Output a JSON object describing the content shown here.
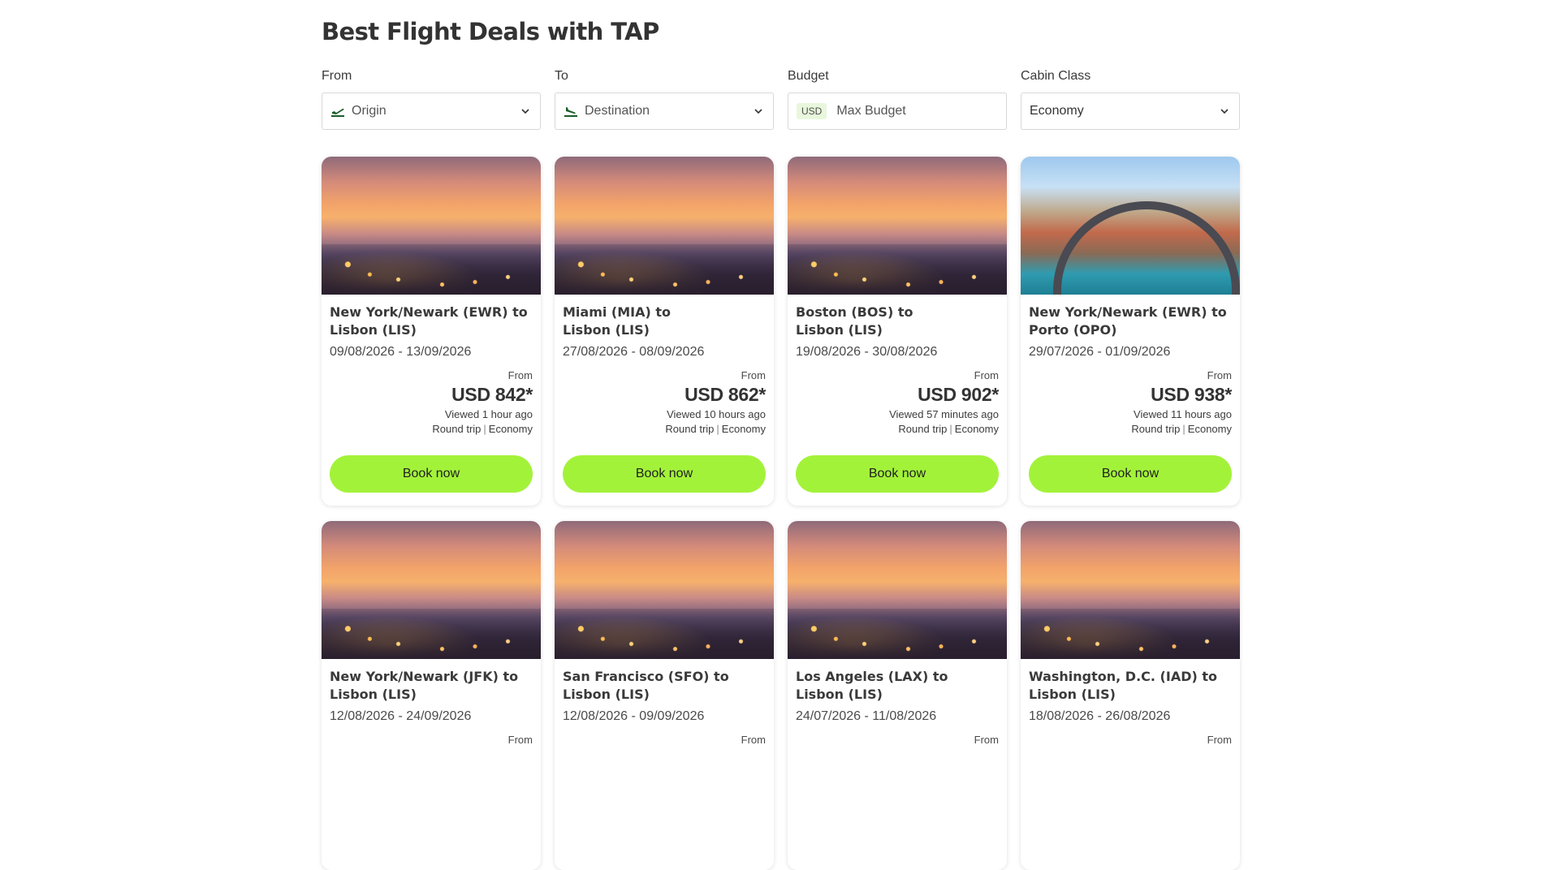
{
  "title": "Best Flight Deals with TAP",
  "filters": {
    "from": {
      "label": "From",
      "placeholder": "Origin",
      "icon": "plane-takeoff-icon"
    },
    "to": {
      "label": "To",
      "placeholder": "Destination",
      "icon": "plane-landing-icon"
    },
    "budget": {
      "label": "Budget",
      "currency": "USD",
      "placeholder": "Max Budget"
    },
    "cabin": {
      "label": "Cabin Class",
      "value": "Economy"
    }
  },
  "deals": [
    {
      "route_line1": "New York/Newark (EWR) to",
      "route_line2": "Lisbon (LIS)",
      "dates": "09/08/2026 - 13/09/2026",
      "from_label": "From",
      "price": "USD 842*",
      "viewed": "Viewed 1 hour ago",
      "trip_type": "Round trip",
      "cabin": "Economy",
      "button": "Book now",
      "image": "lisbon-sunset"
    },
    {
      "route_line1": "Miami (MIA) to",
      "route_line2": "Lisbon (LIS)",
      "dates": "27/08/2026 - 08/09/2026",
      "from_label": "From",
      "price": "USD 862*",
      "viewed": "Viewed 10 hours ago",
      "trip_type": "Round trip",
      "cabin": "Economy",
      "button": "Book now",
      "image": "lisbon-sunset"
    },
    {
      "route_line1": "Boston (BOS) to",
      "route_line2": "Lisbon (LIS)",
      "dates": "19/08/2026 - 30/08/2026",
      "from_label": "From",
      "price": "USD 902*",
      "viewed": "Viewed 57 minutes ago",
      "trip_type": "Round trip",
      "cabin": "Economy",
      "button": "Book now",
      "image": "lisbon-sunset"
    },
    {
      "route_line1": "New York/Newark (EWR) to",
      "route_line2": "Porto (OPO)",
      "dates": "29/07/2026 - 01/09/2026",
      "from_label": "From",
      "price": "USD 938*",
      "viewed": "Viewed 11 hours ago",
      "trip_type": "Round trip",
      "cabin": "Economy",
      "button": "Book now",
      "image": "porto-bridge"
    },
    {
      "route_line1": "New York/Newark (JFK) to",
      "route_line2": "Lisbon (LIS)",
      "dates": "12/08/2026 - 24/09/2026",
      "from_label": "From",
      "image": "lisbon-sunset"
    },
    {
      "route_line1": "San Francisco (SFO) to",
      "route_line2": "Lisbon (LIS)",
      "dates": "12/08/2026 - 09/09/2026",
      "from_label": "From",
      "image": "lisbon-sunset"
    },
    {
      "route_line1": "Los Angeles (LAX) to",
      "route_line2": "Lisbon (LIS)",
      "dates": "24/07/2026 - 11/08/2026",
      "from_label": "From",
      "image": "lisbon-sunset"
    },
    {
      "route_line1": "Washington, D.C. (IAD) to",
      "route_line2": "Lisbon (LIS)",
      "dates": "18/08/2026 - 26/08/2026",
      "from_label": "From",
      "image": "lisbon-sunset"
    }
  ],
  "colors": {
    "accent": "#a3f23a",
    "badge_bg": "#e8f7dc"
  }
}
